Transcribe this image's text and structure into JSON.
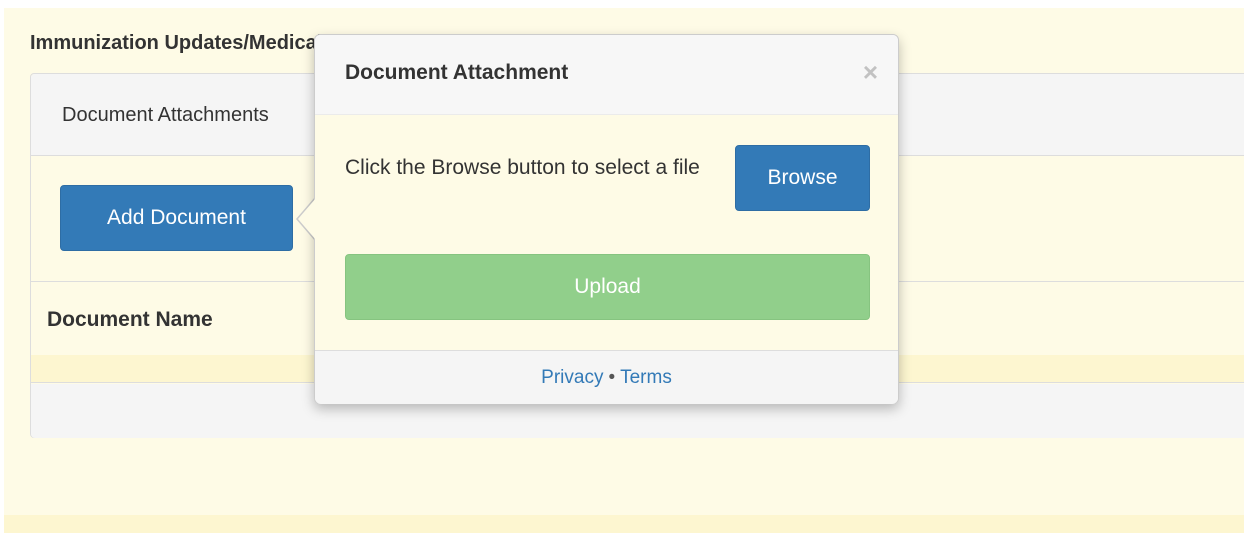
{
  "section": {
    "title": "Immunization Updates/Medical Exemptions"
  },
  "panel": {
    "heading": "Document Attachments",
    "add_button_label": "Add Document",
    "table": {
      "columns": [
        "Document Name"
      ]
    }
  },
  "popover": {
    "title": "Document Attachment",
    "close_glyph": "×",
    "instructions": "Click the Browse button to select a file",
    "browse_label": "Browse",
    "upload_label": "Upload",
    "footer": {
      "privacy_label": "Privacy",
      "separator": "•",
      "terms_label": "Terms"
    }
  },
  "colors": {
    "primary": "#337ab7",
    "success_disabled": "#91cf8b",
    "page_background": "#fefbe6"
  }
}
